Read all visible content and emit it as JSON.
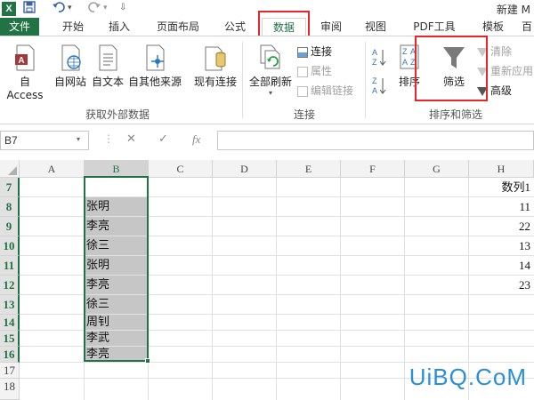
{
  "titlebar": {
    "app_logo": "X",
    "save_icon": "save-icon",
    "undo_icon": "undo-icon",
    "redo_icon": "redo-icon",
    "title": "新建 M"
  },
  "tabs": {
    "file": "文件",
    "home": "开始",
    "insert": "插入",
    "page_layout": "页面布局",
    "formulas": "公式",
    "data": "数据",
    "review": "审阅",
    "view": "视图",
    "pdf": "PDF工具",
    "template": "模板",
    "more": "百"
  },
  "ribbon": {
    "get_external": {
      "access": "自 Access",
      "web": "自网站",
      "text": "自文本",
      "other": "自其他来源",
      "existing": "现有连接",
      "label": "获取外部数据"
    },
    "connections": {
      "refresh_all": "全部刷新",
      "connections": "连接",
      "properties": "属性",
      "edit_links": "编辑链接",
      "label": "连接"
    },
    "sort_filter": {
      "az": "A→Z",
      "za": "Z→A",
      "sort": "排序",
      "filter": "筛选",
      "clear": "清除",
      "reapply": "重新应用",
      "advanced": "高级",
      "label": "排序和筛选"
    }
  },
  "formula_bar": {
    "name_box": "B7",
    "cancel": "✕",
    "enter": "✓",
    "fx": "fx",
    "value": ""
  },
  "grid": {
    "columns": [
      "A",
      "B",
      "C",
      "D",
      "E",
      "F",
      "G",
      "H"
    ],
    "rows": [
      "7",
      "8",
      "9",
      "10",
      "11",
      "12",
      "13",
      "14",
      "15",
      "16",
      "17",
      "18"
    ],
    "col_b": [
      "",
      "张明",
      "李亮",
      "徐三",
      "张明",
      "李亮",
      "徐三",
      "周钊",
      "李武",
      "李亮"
    ],
    "col_h": [
      "数列1",
      "11",
      "22",
      "13",
      "14",
      "23"
    ]
  },
  "watermark": "UiBQ.CoM",
  "colors": {
    "excel_green": "#217346",
    "highlight_red": "#e8262a",
    "selection_gray": "#c6c6c6"
  }
}
